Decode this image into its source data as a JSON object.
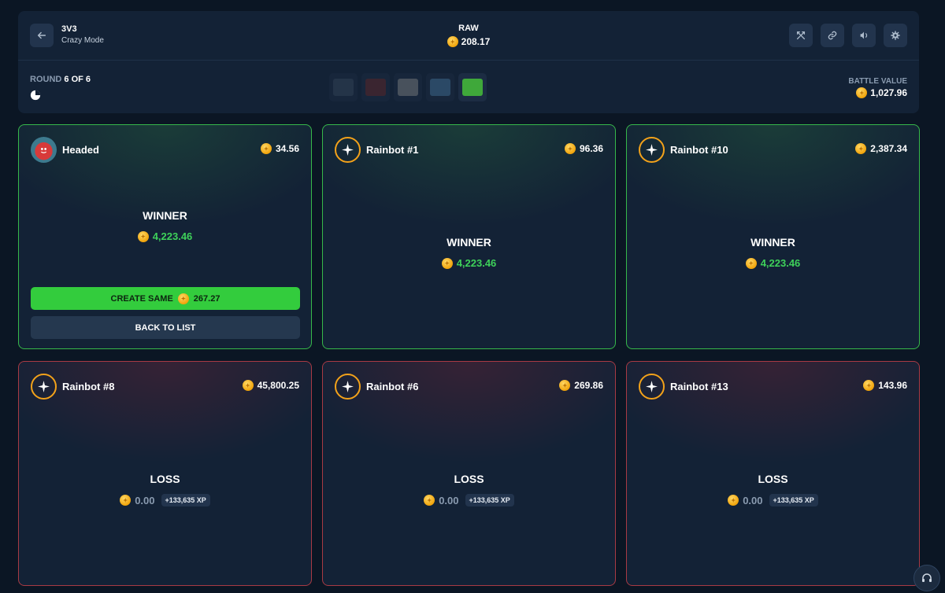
{
  "header": {
    "mode_title": "3V3",
    "mode_subtitle": "Crazy Mode",
    "center_title": "RAW",
    "center_value": "208.17",
    "round_label": "ROUND",
    "round_value": "6 OF 6",
    "battle_value_label": "BATTLE VALUE",
    "battle_value": "1,027.96",
    "icons": [
      "back-arrow-icon",
      "swords-icon",
      "link-icon",
      "volume-icon",
      "settings-icon"
    ],
    "cases": [
      {
        "name": "case-1",
        "color": "#3a4a5e"
      },
      {
        "name": "case-2",
        "color": "#6b2a2a"
      },
      {
        "name": "case-3",
        "color": "#8a8a8a"
      },
      {
        "name": "case-4",
        "color": "#4a7aa0"
      },
      {
        "name": "case-5",
        "color": "#3fa83a"
      }
    ]
  },
  "players": [
    {
      "name": "Headed",
      "value": "34.56",
      "result": "WINNER",
      "amount": "4,223.46",
      "outcome": "win",
      "avatar": "user"
    },
    {
      "name": "Rainbot #1",
      "value": "96.36",
      "result": "WINNER",
      "amount": "4,223.46",
      "outcome": "win",
      "avatar": "bot"
    },
    {
      "name": "Rainbot #10",
      "value": "2,387.34",
      "result": "WINNER",
      "amount": "4,223.46",
      "outcome": "win",
      "avatar": "bot"
    },
    {
      "name": "Rainbot #8",
      "value": "45,800.25",
      "result": "LOSS",
      "amount": "0.00",
      "xp": "+133,635 XP",
      "outcome": "loss",
      "avatar": "bot"
    },
    {
      "name": "Rainbot #6",
      "value": "269.86",
      "result": "LOSS",
      "amount": "0.00",
      "xp": "+133,635 XP",
      "outcome": "loss",
      "avatar": "bot"
    },
    {
      "name": "Rainbot #13",
      "value": "143.96",
      "result": "LOSS",
      "amount": "0.00",
      "xp": "+133,635 XP",
      "outcome": "loss",
      "avatar": "bot"
    }
  ],
  "actions": {
    "create_same_label": "CREATE SAME",
    "create_same_value": "267.27",
    "back_to_list_label": "BACK TO LIST"
  },
  "colors": {
    "win": "#36b84a",
    "loss": "#a83a44",
    "coin": "#f0a30a",
    "green_button": "#33cc3d"
  }
}
